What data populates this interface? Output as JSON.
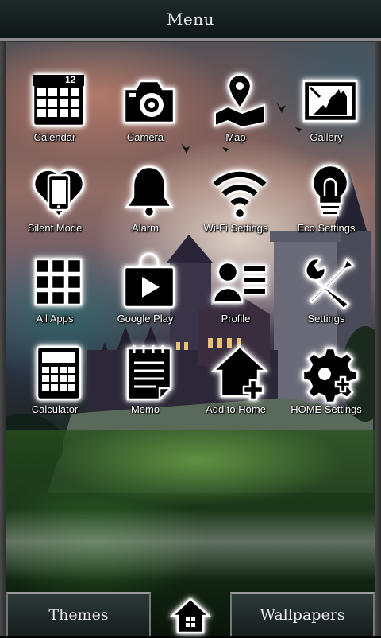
{
  "header": {
    "title": "Menu"
  },
  "apps": [
    {
      "label": "Calendar",
      "icon": "calendar-icon",
      "badge": "12"
    },
    {
      "label": "Camera",
      "icon": "camera-icon"
    },
    {
      "label": "Map",
      "icon": "map-icon"
    },
    {
      "label": "Gallery",
      "icon": "gallery-icon"
    },
    {
      "label": "Silent Mode",
      "icon": "silent-mode-icon"
    },
    {
      "label": "Alarm",
      "icon": "bell-icon"
    },
    {
      "label": "Wi-Fi Settings",
      "icon": "wifi-icon"
    },
    {
      "label": "Eco Settings",
      "icon": "lightbulb-icon"
    },
    {
      "label": "All Apps",
      "icon": "grid-icon"
    },
    {
      "label": "Google Play",
      "icon": "play-store-icon"
    },
    {
      "label": "Profile",
      "icon": "profile-icon"
    },
    {
      "label": "Settings",
      "icon": "tools-icon"
    },
    {
      "label": "Calculator",
      "icon": "calculator-icon"
    },
    {
      "label": "Memo",
      "icon": "memo-icon"
    },
    {
      "label": "Add to Home",
      "icon": "add-home-icon"
    },
    {
      "label": "HOME Settings",
      "icon": "gear-plus-icon"
    }
  ],
  "bottombar": {
    "themes_label": "Themes",
    "home_icon": "home-icon",
    "wallpapers_label": "Wallpapers"
  },
  "colors": {
    "icon_fill": "#000000",
    "icon_glow": "#ffffff",
    "bar_border": "#9a9a9a"
  }
}
